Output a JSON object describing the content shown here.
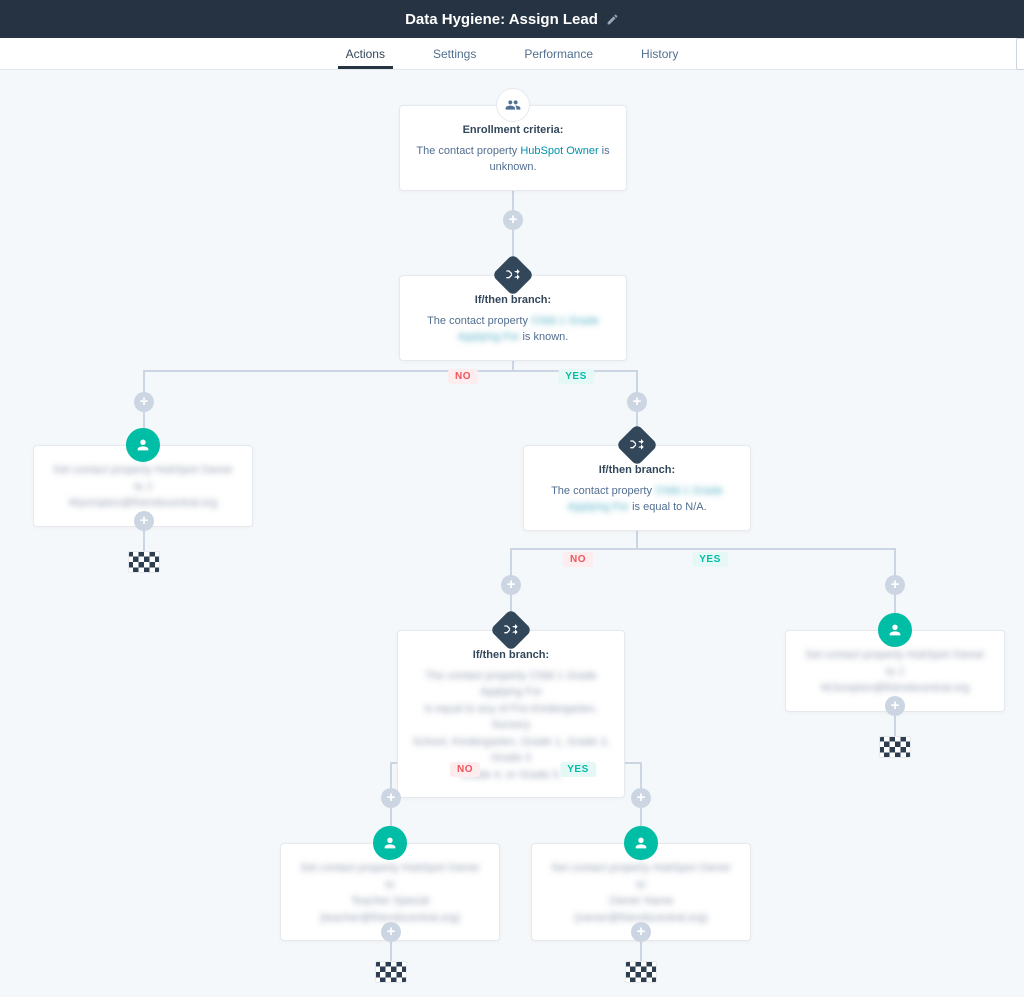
{
  "header": {
    "title": "Data Hygiene: Assign Lead"
  },
  "tabs": {
    "actions": "Actions",
    "settings": "Settings",
    "performance": "Performance",
    "history": "History"
  },
  "labels": {
    "yes": "YES",
    "no": "NO"
  },
  "nodes": {
    "enroll": {
      "title": "Enrollment criteria:",
      "pre": "The contact property ",
      "link": "HubSpot Owner",
      "post": " is unknown."
    },
    "branch1": {
      "title": "If/then branch:",
      "pre": "The contact property ",
      "prop": "Child 1 Grade Applying For",
      "post": " is known."
    },
    "actionLeft": {
      "line1": "Set contact property HubSpot Owner to J",
      "line2": "Wyompton@friendscentral.org"
    },
    "branch2": {
      "title": "If/then branch:",
      "pre": "The contact property ",
      "prop": "Child 1 Grade Applying For",
      "post": " is equal to N/A."
    },
    "actionRight": {
      "line1": "Set contact property HubSpot Owner to J",
      "line2": "WJompton@friendscentral.org"
    },
    "branch3": {
      "title": "If/then branch:",
      "line1": "The contact property Child 1 Grade Applying For",
      "line2": "is equal to any of Pre-Kindergarten, Nursery",
      "line3": "School, Kindergarten, Grade 1, Grade 2, Grade 3",
      "line4": "Grade 4, or Grade 5."
    },
    "actionBL": {
      "line1": "Set contact property HubSpot Owner to",
      "line2": "Teacher Special",
      "line3": "(teacher@friendscentral.org)"
    },
    "actionBR": {
      "line1": "Set contact property HubSpot Owner to",
      "line2": "Owner Name (owner@friendscentral.org)"
    }
  }
}
